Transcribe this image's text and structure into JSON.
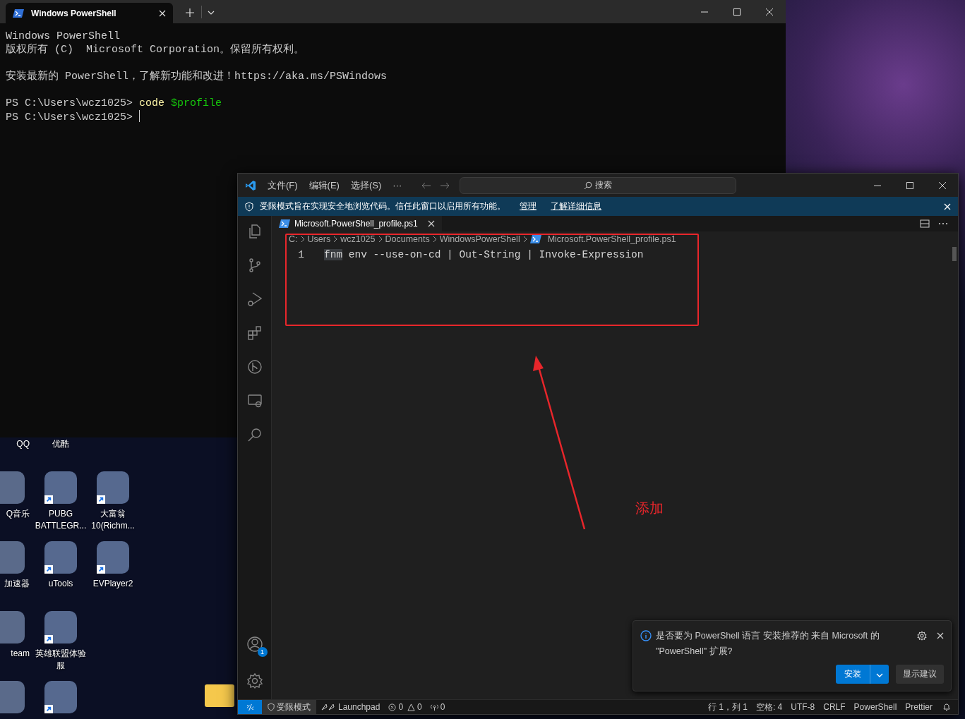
{
  "desktop": {
    "rows": [
      [
        {
          "label": "QQ",
          "kind": "label"
        },
        {
          "label": "优酷",
          "kind": "label"
        }
      ],
      [
        {
          "label": "Q音乐",
          "kind": "app",
          "shortcut": false
        },
        {
          "label": "PUBG BATTLEGR...",
          "kind": "app",
          "shortcut": true
        },
        {
          "label": "大富翁 10(Richm...",
          "kind": "app",
          "shortcut": true
        }
      ],
      [
        {
          "label": "加速器",
          "kind": "app",
          "shortcut": false
        },
        {
          "label": "uTools",
          "kind": "app",
          "shortcut": true
        },
        {
          "label": "EVPlayer2",
          "kind": "app",
          "shortcut": true
        }
      ],
      [
        {
          "label": "team",
          "kind": "app",
          "shortcut": false
        },
        {
          "label": "英雄联盟体验服",
          "kind": "app",
          "shortcut": true
        }
      ],
      [
        {
          "kind": "app",
          "shortcut": false
        },
        {
          "kind": "app",
          "shortcut": true
        }
      ]
    ]
  },
  "terminal": {
    "tabs": [
      {
        "title": "Windows PowerShell",
        "selected": true
      }
    ],
    "paragraphs": [
      [
        [
          {
            "text": "Windows PowerShell",
            "kind": "plain"
          }
        ],
        [
          {
            "text": "版权所有 (C)  Microsoft Corporation。保留所有权利。",
            "kind": "plain"
          }
        ]
      ],
      [
        [
          {
            "text": "安装最新的 PowerShell，了解新功能和改进！https://aka.ms/PSWindows",
            "kind": "plain"
          }
        ]
      ],
      [
        [
          {
            "text": "PS C:\\Users\\wcz1025> ",
            "kind": "plain"
          },
          {
            "text": "code",
            "kind": "command"
          },
          {
            "text": "$profile",
            "kind": "argument"
          }
        ],
        [
          {
            "text": "PS C:\\Users\\wcz1025> ",
            "kind": "plain"
          },
          {
            "kind": "cursor"
          }
        ]
      ]
    ]
  },
  "vscode": {
    "menu": [
      "文件(F)",
      "编辑(E)",
      "选择(S)",
      "···"
    ],
    "search": {
      "placeholder": "搜索"
    },
    "banner": {
      "message": "受限模式旨在实现安全地浏览代码。信任此窗口以启用所有功能。",
      "links": [
        "管理",
        "了解详细信息"
      ]
    },
    "activity_bar": [
      {
        "kind": "explorer"
      },
      {
        "kind": "source-control"
      },
      {
        "kind": "run-debug"
      },
      {
        "kind": "extensions"
      },
      {
        "kind": "git-graph"
      },
      {
        "kind": "remote"
      },
      {
        "kind": "search"
      }
    ],
    "accounts_badge": "1",
    "tabs": [
      {
        "title": "Microsoft.PowerShell_profile.ps1",
        "selected": true
      }
    ],
    "breadcrumb": [
      "C:",
      "Users",
      "wcz1025",
      "Documents",
      "WindowsPowerShell",
      "Microsoft.PowerShell_profile.ps1"
    ],
    "code": [
      {
        "number": "1",
        "tokens": [
          {
            "text": "fnm",
            "kind": "highlight"
          },
          {
            "text": " env --use-on-cd ",
            "kind": "plain"
          },
          {
            "text": "|",
            "kind": "plain"
          },
          {
            "text": " Out-String ",
            "kind": "plain"
          },
          {
            "text": "|",
            "kind": "plain"
          },
          {
            "text": " Invoke-Expression",
            "kind": "plain"
          }
        ]
      }
    ],
    "notification": {
      "message": "是否要为 PowerShell 语言 安装推荐的 来自 Microsoft 的 \"PowerShell\" 扩展?",
      "primary": "安装",
      "secondary": "显示建议"
    },
    "status_bar": {
      "left": [
        {
          "text": "受限模式",
          "kind": "restricted"
        },
        {
          "text": "Launchpad",
          "kind": "launchpad"
        },
        {
          "text": "0",
          "kind": "errors"
        },
        {
          "text": "0",
          "kind": "warnings"
        },
        {
          "text": "0",
          "kind": "ports"
        }
      ],
      "right": [
        "行 1，列 1",
        "空格: 4",
        "UTF-8",
        "CRLF",
        "PowerShell",
        "Prettier"
      ]
    }
  },
  "annotation": {
    "label": "添加"
  }
}
